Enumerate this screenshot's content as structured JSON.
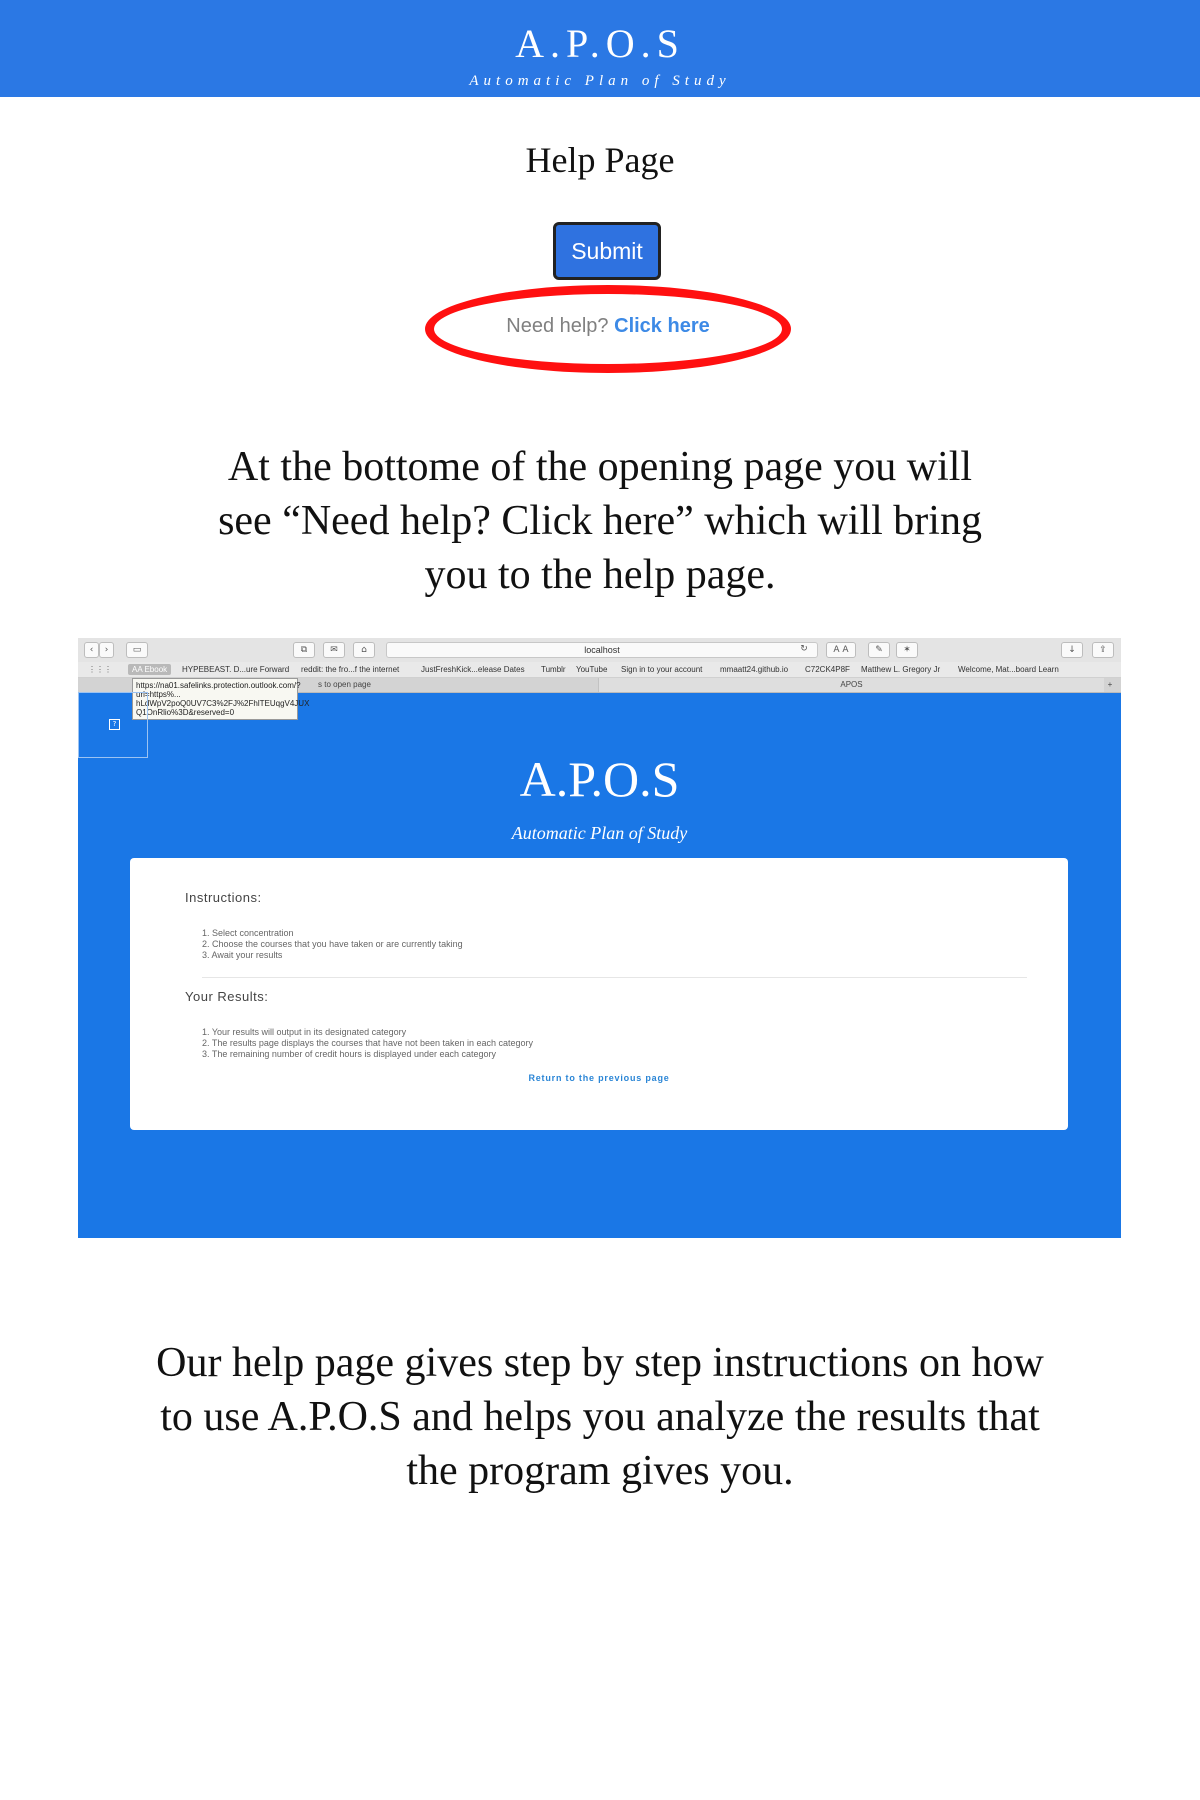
{
  "header": {
    "title": "A.P.O.S",
    "subtitle": "Automatic Plan of Study"
  },
  "page_heading": "Help Page",
  "example": {
    "submit_label": "Submit",
    "need_help_text": "Need help?",
    "click_here_text": "Click here"
  },
  "paragraph_1": {
    "lines": [
      "At the bottome of the opening page you will",
      "see “Need help? Click here” which will bring",
      "you to the help page."
    ]
  },
  "screenshot": {
    "url_text": "localhost",
    "bookmarks": [
      "AA Ebook",
      "HYPEBEAST. D...ure Forward",
      "reddit: the fro...f the internet",
      "JustFreshKick...elease Dates",
      "Tumblr",
      "YouTube",
      "Sign in to your account",
      "mmaatt24.github.io",
      "C72CK4P8F",
      "Matthew L. Gregory Jr",
      "Welcome, Mat...board Learn"
    ],
    "tab_left_fragment": "s to open page",
    "tab_right": "APOS",
    "tooltip_lines": [
      "https://na01.safelinks.protection.outlook.com/?",
      "url=https%...",
      "hLdWpV2poQ0UV7C3%2FJ%2FhlTEUqgV4JUX",
      "Q1OnRlio%3D&reserved=0"
    ],
    "app_title": "A.P.O.S",
    "app_subtitle": "Automatic Plan of Study",
    "instructions_heading": "Instructions:",
    "instructions": [
      "1. Select concentration",
      "2. Choose the courses that you have taken or are currently taking",
      "3. Await your results"
    ],
    "results_heading": "Your Results:",
    "results": [
      "1. Your results will output in its designated category",
      "2. The results page displays the courses that have not been taken in each category",
      "3. The remaining number of credit hours is displayed under each category"
    ],
    "return_link": "Return to the previous page"
  },
  "paragraph_2": {
    "lines": [
      "Our help page gives step by step instructions on how",
      "to use A.P.O.S and helps you analyze the results that",
      "the program gives you."
    ]
  },
  "colors": {
    "banner": "#2b78e4",
    "highlight_oval": "#ff1010",
    "link": "#3d8ae6",
    "screenshot_background": "#1a77e6"
  }
}
